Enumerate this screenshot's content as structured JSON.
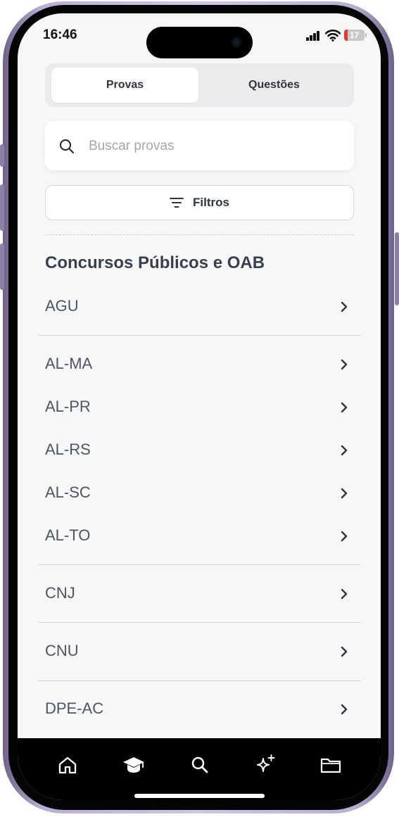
{
  "status_bar": {
    "time": "16:46",
    "battery_level": "17"
  },
  "tabs": {
    "provas": "Provas",
    "questoes": "Questões",
    "active": "provas"
  },
  "search": {
    "placeholder": "Buscar provas"
  },
  "filters": {
    "label": "Filtros"
  },
  "section": {
    "title": "Concursos Públicos e OAB"
  },
  "list": [
    {
      "label": "AGU"
    },
    {
      "label": "AL-MA"
    },
    {
      "label": "AL-PR"
    },
    {
      "label": "AL-RS"
    },
    {
      "label": "AL-SC"
    },
    {
      "label": "AL-TO"
    },
    {
      "label": "CNJ"
    },
    {
      "label": "CNU"
    },
    {
      "label": "DPE-AC"
    }
  ],
  "bottom_nav": [
    "home-icon",
    "graduation-cap-icon",
    "search-icon",
    "sparkles-icon",
    "folder-icon"
  ],
  "colors": {
    "background": "#f7f7f7",
    "text_dark": "#2f3440",
    "battery_low": "#e23b33",
    "tab_bar": "#000000"
  }
}
